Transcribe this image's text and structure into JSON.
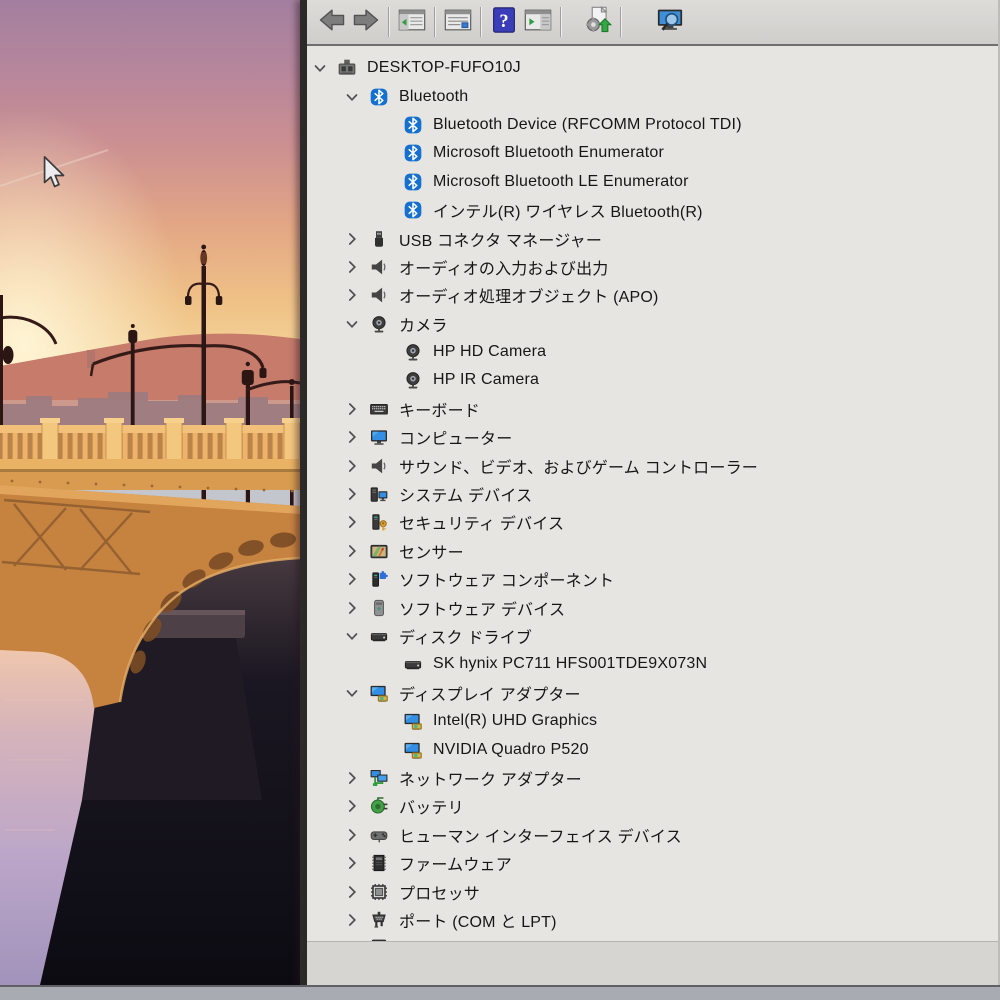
{
  "toolbar": {
    "buttons": [
      {
        "name": "back-button",
        "icon": "back-arrow-icon"
      },
      {
        "name": "forward-button",
        "icon": "forward-arrow-icon"
      },
      {
        "name": "console-tree-button",
        "icon": "console-tree-window-icon"
      },
      {
        "name": "properties-button",
        "icon": "properties-window-icon"
      },
      {
        "name": "help-button",
        "icon": "help-icon"
      },
      {
        "name": "action-pane-button",
        "icon": "action-pane-window-icon"
      },
      {
        "name": "update-driver-button",
        "icon": "update-driver-icon"
      },
      {
        "name": "scan-hardware-button",
        "icon": "scan-hardware-icon"
      }
    ]
  },
  "tree": {
    "items": [
      {
        "level": 0,
        "state": "expanded",
        "icon": "computer-icon",
        "label": "DESKTOP-FUFO10J"
      },
      {
        "level": 1,
        "state": "expanded",
        "icon": "bluetooth-icon",
        "label": "Bluetooth"
      },
      {
        "level": 2,
        "state": "leaf",
        "icon": "bluetooth-icon",
        "label": "Bluetooth Device (RFCOMM Protocol TDI)"
      },
      {
        "level": 2,
        "state": "leaf",
        "icon": "bluetooth-icon",
        "label": "Microsoft Bluetooth Enumerator"
      },
      {
        "level": 2,
        "state": "leaf",
        "icon": "bluetooth-icon",
        "label": "Microsoft Bluetooth LE Enumerator"
      },
      {
        "level": 2,
        "state": "leaf",
        "icon": "bluetooth-icon",
        "label": "インテル(R) ワイヤレス Bluetooth(R)"
      },
      {
        "level": 1,
        "state": "collapsed",
        "icon": "usb-icon",
        "label": "USB コネクタ マネージャー"
      },
      {
        "level": 1,
        "state": "collapsed",
        "icon": "audio-icon",
        "label": "オーディオの入力および出力"
      },
      {
        "level": 1,
        "state": "collapsed",
        "icon": "audio-icon",
        "label": "オーディオ処理オブジェクト (APO)"
      },
      {
        "level": 1,
        "state": "expanded",
        "icon": "camera-icon",
        "label": "カメラ"
      },
      {
        "level": 2,
        "state": "leaf",
        "icon": "camera-icon",
        "label": "HP HD Camera"
      },
      {
        "level": 2,
        "state": "leaf",
        "icon": "camera-icon",
        "label": "HP IR Camera"
      },
      {
        "level": 1,
        "state": "collapsed",
        "icon": "keyboard-icon",
        "label": "キーボード"
      },
      {
        "level": 1,
        "state": "collapsed",
        "icon": "monitor-icon",
        "label": "コンピューター"
      },
      {
        "level": 1,
        "state": "collapsed",
        "icon": "audio-icon",
        "label": "サウンド、ビデオ、およびゲーム コントローラー"
      },
      {
        "level": 1,
        "state": "collapsed",
        "icon": "system-devices-icon",
        "label": "システム デバイス"
      },
      {
        "level": 1,
        "state": "collapsed",
        "icon": "security-device-icon",
        "label": "セキュリティ デバイス"
      },
      {
        "level": 1,
        "state": "collapsed",
        "icon": "sensor-icon",
        "label": "センサー"
      },
      {
        "level": 1,
        "state": "collapsed",
        "icon": "software-component-icon",
        "label": "ソフトウェア コンポーネント"
      },
      {
        "level": 1,
        "state": "collapsed",
        "icon": "software-device-icon",
        "label": "ソフトウェア デバイス"
      },
      {
        "level": 1,
        "state": "expanded",
        "icon": "disk-drive-icon",
        "label": "ディスク ドライブ"
      },
      {
        "level": 2,
        "state": "leaf",
        "icon": "disk-drive-icon",
        "label": "SK hynix PC711 HFS001TDE9X073N"
      },
      {
        "level": 1,
        "state": "expanded",
        "icon": "display-adapter-icon",
        "label": "ディスプレイ アダプター"
      },
      {
        "level": 2,
        "state": "leaf",
        "icon": "display-adapter-icon",
        "label": "Intel(R) UHD Graphics"
      },
      {
        "level": 2,
        "state": "leaf",
        "icon": "display-adapter-icon",
        "label": "NVIDIA Quadro P520"
      },
      {
        "level": 1,
        "state": "collapsed",
        "icon": "network-adapter-icon",
        "label": "ネットワーク アダプター"
      },
      {
        "level": 1,
        "state": "collapsed",
        "icon": "battery-icon",
        "label": "バッテリ"
      },
      {
        "level": 1,
        "state": "collapsed",
        "icon": "hid-icon",
        "label": "ヒューマン インターフェイス デバイス"
      },
      {
        "level": 1,
        "state": "collapsed",
        "icon": "firmware-icon",
        "label": "ファームウェア"
      },
      {
        "level": 1,
        "state": "collapsed",
        "icon": "processor-icon",
        "label": "プロセッサ"
      },
      {
        "level": 1,
        "state": "collapsed",
        "icon": "port-icon",
        "label": "ポート (COM と LPT)"
      }
    ],
    "clipped_row": true
  },
  "wallpaper": {
    "scene": "sunset bridge with ornate lamp posts, hills and water reflection",
    "cursor_visible": true,
    "colors": {
      "sky_top": "#a37f9f",
      "sky_mid": "#cc9091",
      "sky_gold": "#f5daa0",
      "hills": "#c67b6b",
      "bridge_gold": "#c6823f",
      "railing": "#edb369",
      "water": "#bda7c9",
      "reflection_dark": "#14121c"
    }
  }
}
